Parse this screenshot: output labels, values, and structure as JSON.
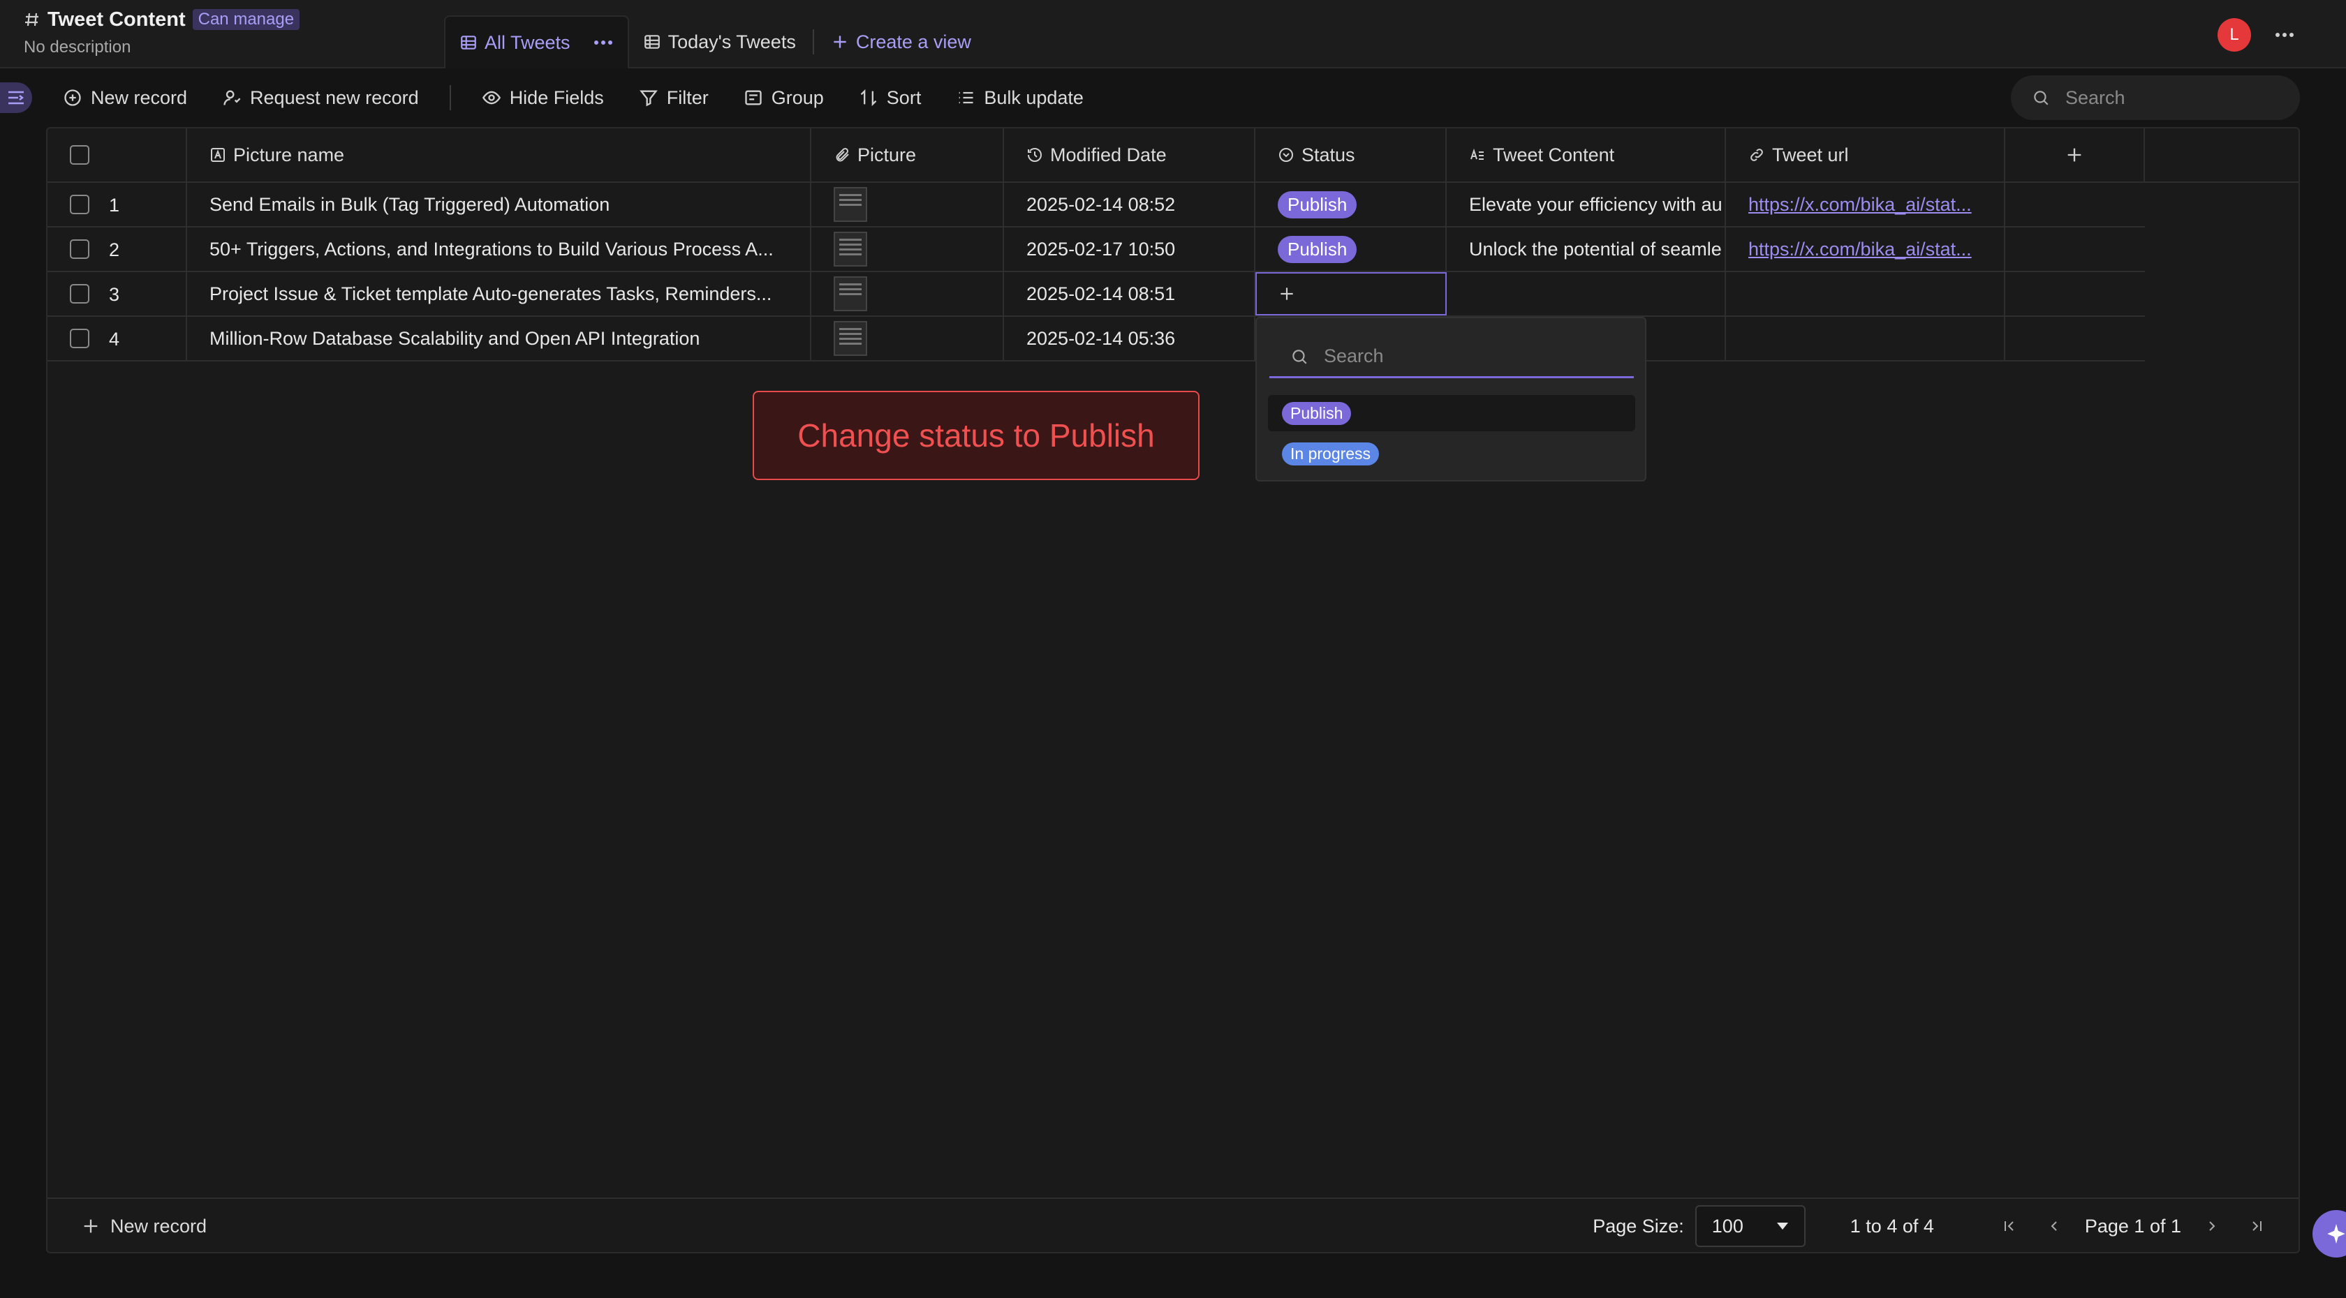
{
  "header": {
    "title": "Tweet Content",
    "permission_badge": "Can manage",
    "description": "No description",
    "tabs": [
      {
        "label": "All Tweets",
        "active": true
      },
      {
        "label": "Today's Tweets",
        "active": false
      }
    ],
    "create_view_label": "Create a view",
    "avatar_letter": "L"
  },
  "toolbar": {
    "new_record": "New record",
    "request_new_record": "Request new record",
    "hide_fields": "Hide Fields",
    "filter": "Filter",
    "group": "Group",
    "sort": "Sort",
    "bulk_update": "Bulk update",
    "search_placeholder": "Search"
  },
  "columns": [
    "Picture name",
    "Picture",
    "Modified Date",
    "Status",
    "Tweet Content",
    "Tweet url"
  ],
  "rows": [
    {
      "num": "1",
      "name": "Send Emails in Bulk (Tag Triggered) Automation",
      "date": "2025-02-14 08:52",
      "status": "Publish",
      "content": "Elevate your efficiency with au",
      "url": "https://x.com/bika_ai/stat..."
    },
    {
      "num": "2",
      "name": "50+ Triggers, Actions, and Integrations to Build Various Process A...",
      "date": "2025-02-17 10:50",
      "status": "Publish",
      "content": "Unlock the potential of seamle",
      "url": "https://x.com/bika_ai/stat..."
    },
    {
      "num": "3",
      "name": "Project Issue & Ticket template Auto-generates Tasks, Reminders...",
      "date": "2025-02-14 08:51",
      "status": "",
      "content": "",
      "url": ""
    },
    {
      "num": "4",
      "name": "Million-Row Database Scalability and Open API Integration",
      "date": "2025-02-14 05:36",
      "status": "",
      "content": "",
      "url": ""
    }
  ],
  "dropdown": {
    "search_placeholder": "Search",
    "options": [
      {
        "label": "Publish",
        "color": "#7b68d9"
      },
      {
        "label": "In progress",
        "color": "#5b86e5"
      }
    ]
  },
  "annotation": "Change status to Publish",
  "footer": {
    "new_record": "New record",
    "page_size_label": "Page Size:",
    "page_size_value": "100",
    "range": "1 to 4 of 4",
    "page_indicator": "Page 1 of 1"
  }
}
